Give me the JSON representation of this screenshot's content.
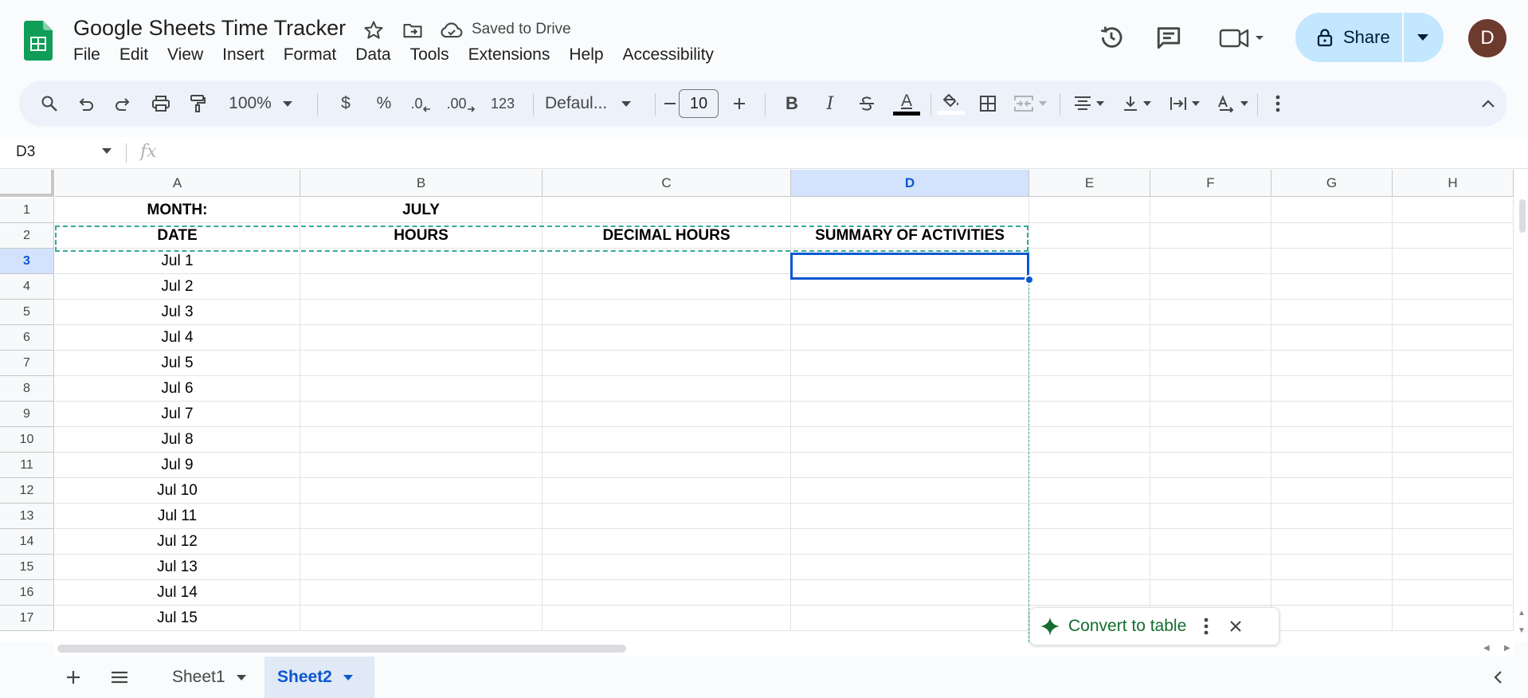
{
  "app": {
    "title": "Google Sheets Time Tracker",
    "saved_status": "Saved to Drive",
    "menus": [
      "File",
      "Edit",
      "View",
      "Insert",
      "Format",
      "Data",
      "Tools",
      "Extensions",
      "Help",
      "Accessibility"
    ],
    "share_label": "Share",
    "avatar_initial": "D"
  },
  "toolbar": {
    "zoom": "100%",
    "currency": "$",
    "percent": "%",
    "decrease_decimal": ".0",
    "increase_decimal": ".00",
    "number_format": "123",
    "font": "Defaul...",
    "font_size": "10",
    "bold": "B",
    "italic": "I",
    "text_color": "A",
    "text_color_hex": "#000000"
  },
  "formula_bar": {
    "name_box": "D3",
    "fx": "fx",
    "formula": ""
  },
  "columns": [
    "A",
    "B",
    "C",
    "D",
    "E",
    "F",
    "G",
    "H"
  ],
  "selected_column": "D",
  "selected_row": 3,
  "rows": [
    {
      "n": "1",
      "cells": [
        "MONTH:",
        "JULY",
        "",
        ""
      ],
      "bold": true
    },
    {
      "n": "2",
      "cells": [
        "DATE",
        "HOURS",
        "DECIMAL HOURS",
        "SUMMARY OF ACTIVITIES"
      ],
      "bold": true
    },
    {
      "n": "3",
      "cells": [
        "Jul 1",
        "",
        "",
        ""
      ]
    },
    {
      "n": "4",
      "cells": [
        "Jul 2",
        "",
        "",
        ""
      ]
    },
    {
      "n": "5",
      "cells": [
        "Jul 3",
        "",
        "",
        ""
      ]
    },
    {
      "n": "6",
      "cells": [
        "Jul 4",
        "",
        "",
        ""
      ]
    },
    {
      "n": "7",
      "cells": [
        "Jul 5",
        "",
        "",
        ""
      ]
    },
    {
      "n": "8",
      "cells": [
        "Jul 6",
        "",
        "",
        ""
      ]
    },
    {
      "n": "9",
      "cells": [
        "Jul 7",
        "",
        "",
        ""
      ]
    },
    {
      "n": "10",
      "cells": [
        "Jul 8",
        "",
        "",
        ""
      ]
    },
    {
      "n": "11",
      "cells": [
        "Jul 9",
        "",
        "",
        ""
      ]
    },
    {
      "n": "12",
      "cells": [
        "Jul 10",
        "",
        "",
        ""
      ]
    },
    {
      "n": "13",
      "cells": [
        "Jul 11",
        "",
        "",
        ""
      ]
    },
    {
      "n": "14",
      "cells": [
        "Jul 12",
        "",
        "",
        ""
      ]
    },
    {
      "n": "15",
      "cells": [
        "Jul 13",
        "",
        "",
        ""
      ]
    },
    {
      "n": "16",
      "cells": [
        "Jul 14",
        "",
        "",
        ""
      ]
    },
    {
      "n": "17",
      "cells": [
        "Jul 15",
        "",
        "",
        ""
      ]
    }
  ],
  "convert_chip": {
    "label": "Convert to table"
  },
  "sheets": {
    "tabs": [
      "Sheet1",
      "Sheet2"
    ],
    "active": "Sheet2"
  },
  "colors": {
    "accent": "#0b57d0",
    "share_bg": "#c2e7ff",
    "copy_border": "#34a89a",
    "convert_green": "#146c2e",
    "avatar_bg": "#6d3a2e"
  }
}
